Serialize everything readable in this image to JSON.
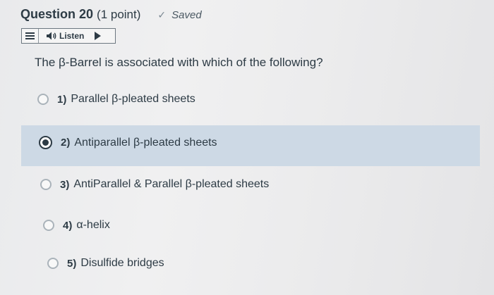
{
  "question": {
    "title": "Question 20",
    "points": "(1 point)",
    "status": "Saved",
    "status_icon": "check-icon"
  },
  "listen": {
    "label": "Listen",
    "icons": [
      "menu-icon",
      "speaker-icon",
      "play-icon"
    ]
  },
  "prompt": "The β-Barrel is associated with which of the following?",
  "options": [
    {
      "number": "1)",
      "text": "Parallel β-pleated sheets",
      "selected": false
    },
    {
      "number": "2)",
      "text": "Antiparallel β-pleated sheets",
      "selected": true
    },
    {
      "number": "3)",
      "text": "AntiParallel & Parallel β-pleated sheets",
      "selected": false
    },
    {
      "number": "4)",
      "text": "α-helix",
      "selected": false
    },
    {
      "number": "5)",
      "text": "Disulfide bridges",
      "selected": false
    }
  ],
  "colors": {
    "text": "#2d3b45",
    "selected_background": "#cdd9e5"
  }
}
